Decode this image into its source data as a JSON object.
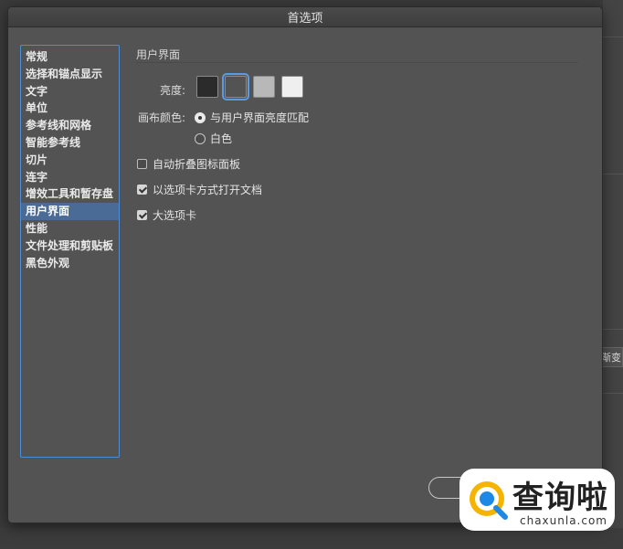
{
  "dialog": {
    "title": "首选项"
  },
  "sidebar": {
    "items": [
      {
        "label": "常规"
      },
      {
        "label": "选择和锚点显示"
      },
      {
        "label": "文字"
      },
      {
        "label": "单位"
      },
      {
        "label": "参考线和网格"
      },
      {
        "label": "智能参考线"
      },
      {
        "label": "切片"
      },
      {
        "label": "连字"
      },
      {
        "label": "增效工具和暂存盘"
      },
      {
        "label": "用户界面"
      },
      {
        "label": "性能"
      },
      {
        "label": "文件处理和剪贴板"
      },
      {
        "label": "黑色外观"
      }
    ],
    "selected_index": 9
  },
  "panel": {
    "section_title": "用户界面",
    "brightness_label": "亮度:",
    "brightness_options": [
      {
        "name": "dark",
        "color": "#2b2b2b"
      },
      {
        "name": "medium-dark",
        "color": "#535353"
      },
      {
        "name": "medium-light",
        "color": "#b8b8b8"
      },
      {
        "name": "light",
        "color": "#efefef"
      }
    ],
    "brightness_selected": "medium-dark",
    "canvas_color_label": "画布颜色:",
    "canvas_options": [
      {
        "label": "与用户界面亮度匹配",
        "selected": true
      },
      {
        "label": "白色",
        "selected": false
      }
    ],
    "checkboxes": [
      {
        "label": "自动折叠图标面板",
        "checked": false
      },
      {
        "label": "以选项卡方式打开文档",
        "checked": true
      },
      {
        "label": "大选项卡",
        "checked": true
      }
    ]
  },
  "background": {
    "side_button_label": "渐变"
  },
  "watermark": {
    "brand_text": "查询啦",
    "url_text": "chaxunla.com"
  },
  "colors": {
    "dialog_bg": "#535353",
    "selection": "#4a6b95",
    "focus_ring": "#4d8cd6"
  }
}
